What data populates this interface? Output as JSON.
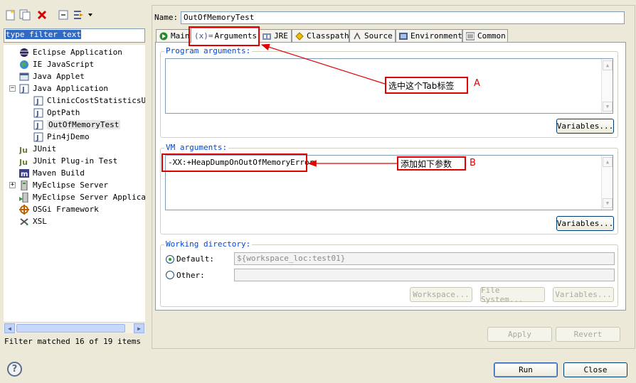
{
  "window": {
    "filter_placeholder": "type filter text",
    "filter_status": "Filter matched 16 of 19 items"
  },
  "tree": {
    "items": [
      {
        "label": "Eclipse Application",
        "icon": "eclipse-icon",
        "level": 0
      },
      {
        "label": "IE JavaScript",
        "icon": "globe-icon",
        "level": 0
      },
      {
        "label": "Java Applet",
        "icon": "applet-icon",
        "level": 0
      },
      {
        "label": "Java Application",
        "icon": "java-app-icon",
        "level": 0
      },
      {
        "label": "ClinicCostStatisticsUti",
        "icon": "java-class-icon",
        "level": 1
      },
      {
        "label": "OptPath",
        "icon": "java-class-icon",
        "level": 1
      },
      {
        "label": "OutOfMemoryTest",
        "icon": "java-class-icon",
        "level": 1,
        "selected": true
      },
      {
        "label": "Pin4jDemo",
        "icon": "java-class-icon",
        "level": 1
      },
      {
        "label": "JUnit",
        "icon": "junit-icon",
        "level": 0
      },
      {
        "label": "JUnit Plug-in Test",
        "icon": "junit-plugin-icon",
        "level": 0
      },
      {
        "label": "Maven Build",
        "icon": "maven-icon",
        "level": 0
      },
      {
        "label": "MyEclipse Server",
        "icon": "server-icon",
        "level": 0
      },
      {
        "label": "MyEclipse Server Applicati",
        "icon": "server-app-icon",
        "level": 0
      },
      {
        "label": "OSGi Framework",
        "icon": "osgi-icon",
        "level": 0
      },
      {
        "label": "XSL",
        "icon": "xsl-icon",
        "level": 0
      }
    ]
  },
  "config": {
    "name_label": "Name:",
    "name_value": "OutOfMemoryTest"
  },
  "tabs": [
    {
      "label": "Main",
      "icon": "main-tab-icon"
    },
    {
      "label": "Arguments",
      "icon": "arguments-tab-icon",
      "prefix": "(x)=",
      "active": true
    },
    {
      "label": "JRE",
      "icon": "jre-tab-icon"
    },
    {
      "label": "Classpath",
      "icon": "classpath-tab-icon"
    },
    {
      "label": "Source",
      "icon": "source-tab-icon"
    },
    {
      "label": "Environment",
      "icon": "environment-tab-icon"
    },
    {
      "label": "Common",
      "icon": "common-tab-icon"
    }
  ],
  "arguments": {
    "program_title": "Program arguments:",
    "program_value": "",
    "program_variables": "Variables...",
    "vm_title": "VM arguments:",
    "vm_value": "-XX:+HeapDumpOnOutOfMemoryError",
    "vm_variables": "Variables...",
    "working_title": "Working directory:",
    "default_label": "Default:",
    "default_value": "${workspace_loc:test01}",
    "other_label": "Other:",
    "other_value": "",
    "workspace_btn": "Workspace...",
    "filesystem_btn": "File System...",
    "variables_btn": "Variables..."
  },
  "actions": {
    "apply": "Apply",
    "revert": "Revert",
    "run": "Run",
    "close": "Close"
  },
  "annotations": {
    "a_text": "选中这个Tab标签",
    "a_letter": "A",
    "b_text": "添加如下参数",
    "b_letter": "B"
  },
  "colors": {
    "annotation": "#e00000",
    "group_title": "#0046d5"
  }
}
